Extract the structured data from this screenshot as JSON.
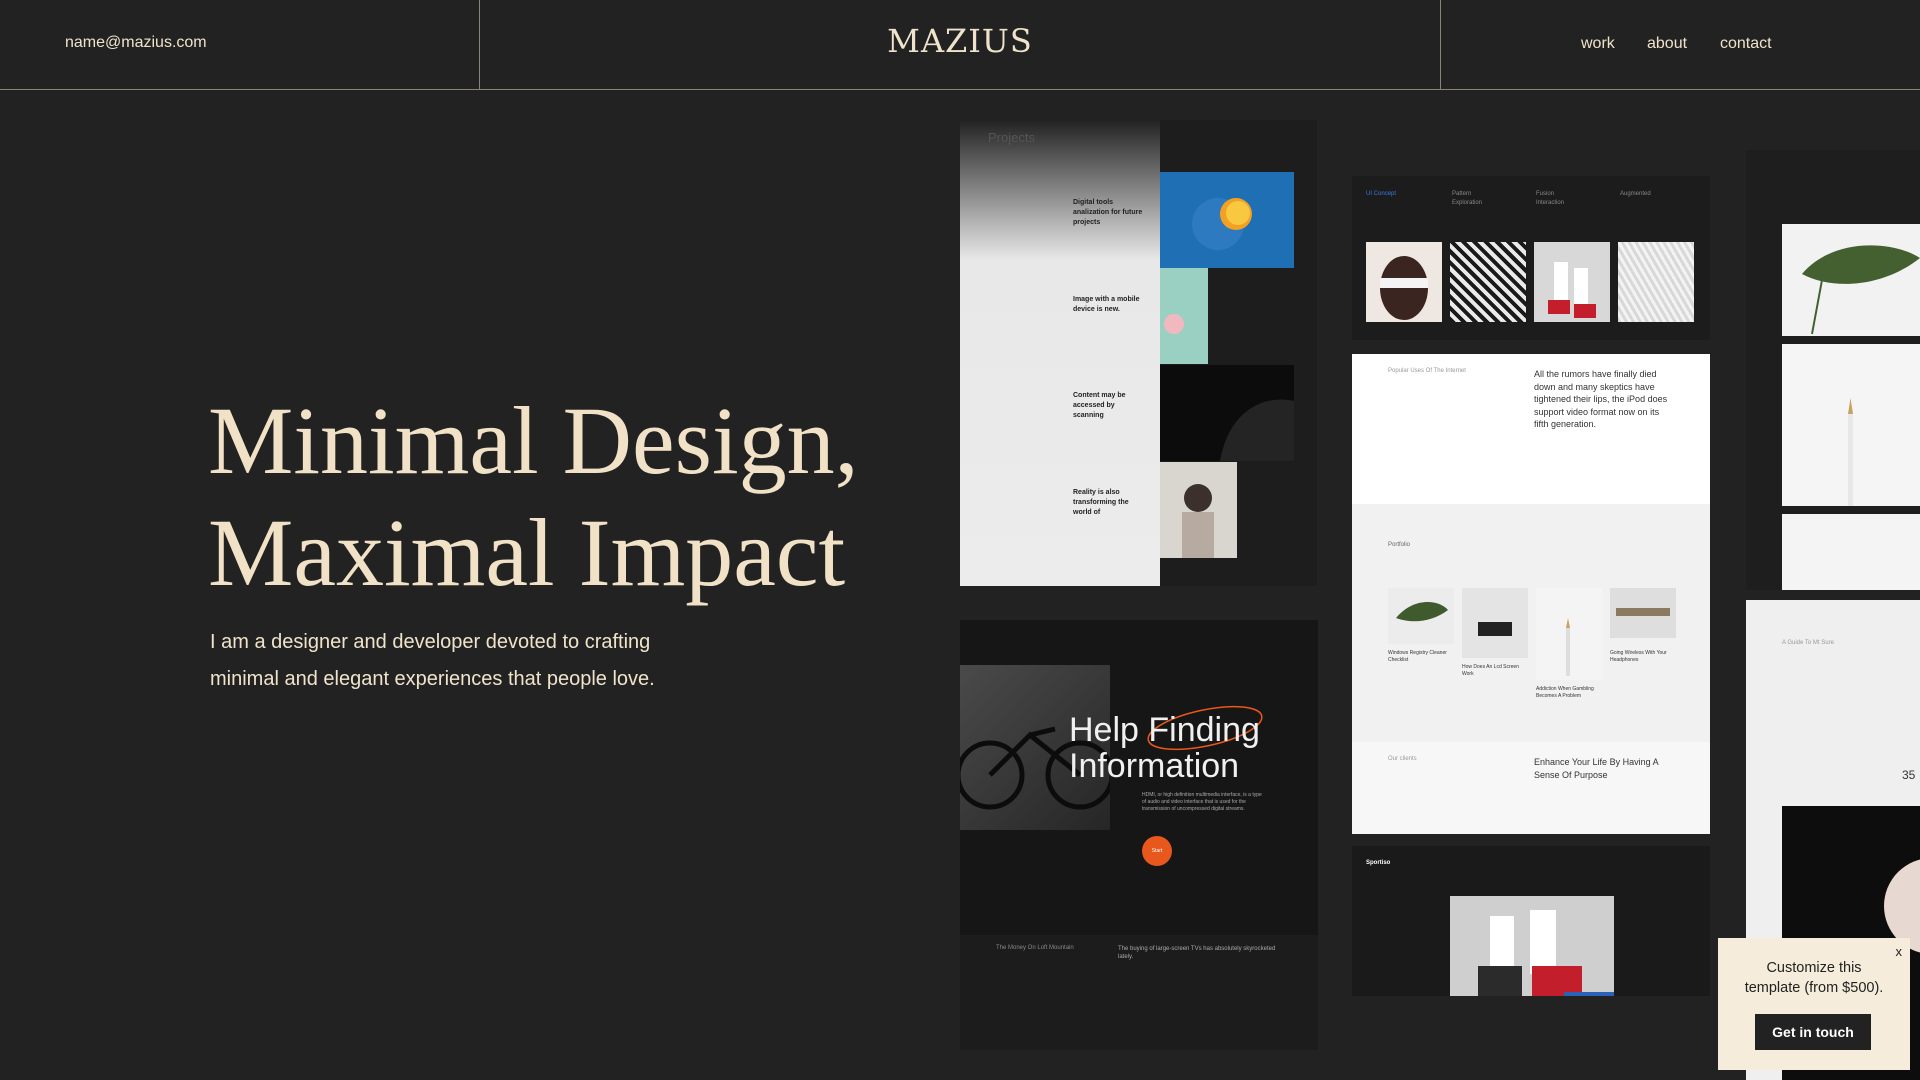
{
  "header": {
    "email": "name@mazius.com",
    "logo": "MAZIUS",
    "nav": [
      "work",
      "about",
      "contact"
    ]
  },
  "hero": {
    "title_line1": "Minimal Design,",
    "title_line2": "Maximal Impact",
    "lead_line1": "I am a designer and developer devoted to crafting",
    "lead_line2": "minimal and elegant experiences that people love."
  },
  "preview": {
    "projects_title": "Projects",
    "project_rows": [
      "Digital tools analization for future projects",
      "Image with a mobile device is new.",
      "Content may be accessed by scanning",
      "Reality is also transforming the world of"
    ],
    "tabs": [
      "UI Concept",
      "Pattern Exploration",
      "Fusion Interaction",
      "Augmented"
    ],
    "quote": "All the rumors have finally died down and many skeptics have tightened their lips, the iPod does support video format now on its fifth generation.",
    "popular_label": "Popular Uses Of The Internet",
    "portfolio_label": "Portfolio",
    "products": [
      "Windows Registry Cleaner Checklist",
      "How Does An Lcd Screen Work",
      "Addiction When Gambling Becomes A Problem",
      "Going Wireless With Your Headphones"
    ],
    "clients_label": "Our clients",
    "enhance": "Enhance Your Life By Having A Sense Of Purpose",
    "help_line1": "Help Finding",
    "help_line2": "Information",
    "help_desc": "HDMI, or high definition multimedia interface, is a type of audio and video interface that is used for the transmission of uncompressed digital streams.",
    "start_label": "Start",
    "money_label": "The Money On Loft Mountain",
    "buying_text": "The buying of large-screen TVs has absolutely skyrocketed lately.",
    "sportiso": "Sportiso",
    "guide_label": "A Guide To Mt Sure",
    "number_fragment": "35"
  },
  "popup": {
    "close": "x",
    "text_line1": "Customize this",
    "text_line2": "template (from $500).",
    "button": "Get in touch"
  }
}
